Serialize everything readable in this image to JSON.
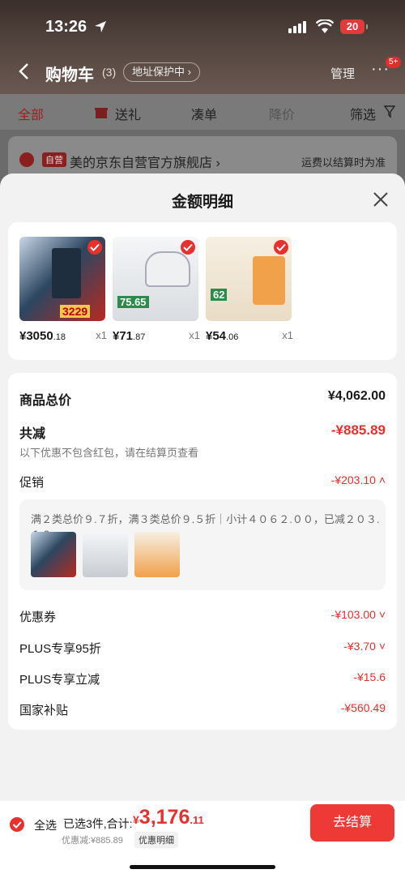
{
  "status_bar": {
    "time": "13:26",
    "battery": "20"
  },
  "header": {
    "title": "购物车",
    "count": "(3)",
    "address_protect": "地址保护中 ›",
    "manage": "管理",
    "more": "···",
    "more_badge": "5+"
  },
  "filters": [
    "全部",
    "送礼",
    "凑单",
    "降价",
    "筛选"
  ],
  "store": {
    "tag": "自营",
    "name": "美的京东自营官方旗舰店 ›",
    "shipping": "运费以结算时为准"
  },
  "sheet": {
    "title": "金额明细",
    "products": [
      {
        "price_int": "¥3050",
        "price_dec": ".18",
        "qty": "x1",
        "thumb_text": "3229",
        "theme": "#2c4660"
      },
      {
        "price_int": "¥71",
        "price_dec": ".87",
        "qty": "x1",
        "thumb_text": "75.65",
        "theme": "#d9dce0"
      },
      {
        "price_int": "¥54",
        "price_dec": ".06",
        "qty": "x1",
        "thumb_text": "62",
        "theme": "#f1a14a"
      }
    ],
    "total_goods_label": "商品总价",
    "total_goods_value": "¥4,062.00",
    "total_reduce_label": "共减",
    "total_reduce_value": "-¥885.89",
    "reduce_note": "以下优惠不包含红包，请在结算页查看",
    "promo_label": "促销",
    "promo_value": "-¥203.10 ˄",
    "promo_detail": "满２类总价９.７折，满３类总价９.５折｜小计４０６２.００，已减２０３.１０",
    "coupon_label": "优惠券",
    "coupon_value": "-¥103.00 ˅",
    "plus95_label": "PLUS专享95折",
    "plus95_value": "-¥3.70 ˅",
    "plus_reduce_label": "PLUS专享立减",
    "plus_reduce_value": "-¥15.6",
    "subsidy_label": "国家补贴",
    "subsidy_value": "-¥560.49"
  },
  "bottom": {
    "select_all": "全选",
    "selected_info": "已选3件,合计:",
    "currency": "¥",
    "total_int": "3,176",
    "total_dec": ".11",
    "reduced": "优惠减:¥885.89",
    "detail_link": "优惠明细",
    "checkout": "去结算"
  },
  "colors": {
    "accent": "#e6312e",
    "checkout": "#ee3a36"
  }
}
